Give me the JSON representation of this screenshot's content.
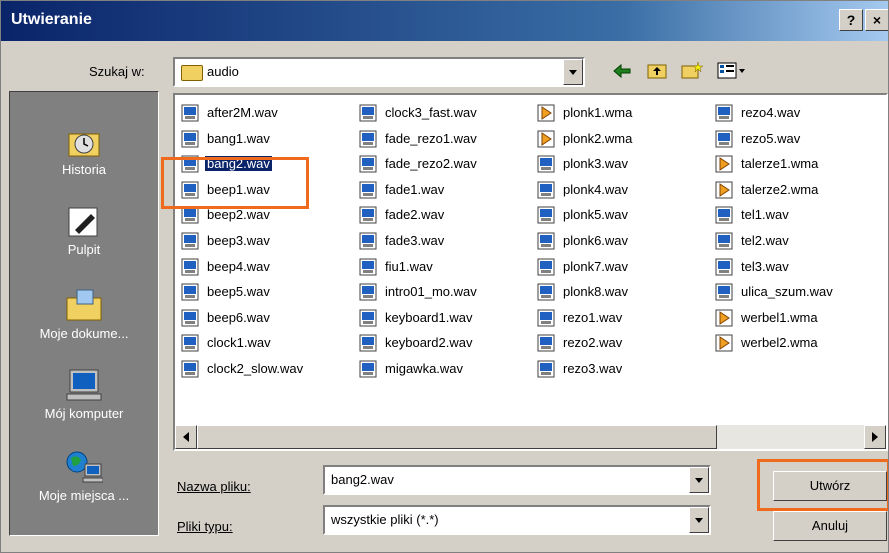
{
  "window": {
    "title": "Utwieranie",
    "help": "?",
    "close": "×"
  },
  "lookin": {
    "label": "Szukaj w:",
    "value": "audio"
  },
  "places": [
    "Historia",
    "Pulpit",
    "Moje dokume...",
    "Mój komputer",
    "Moje miejsca ..."
  ],
  "files": [
    [
      "after2M.wav",
      "bang1.wav",
      "bang2.wav",
      "beep1.wav",
      "beep2.wav",
      "beep3.wav",
      "beep4.wav",
      "beep5.wav",
      "beep6.wav",
      "clock1.wav",
      "clock2_slow.wav"
    ],
    [
      "clock3_fast.wav",
      "fade_rezo1.wav",
      "fade_rezo2.wav",
      "fade1.wav",
      "fade2.wav",
      "fade3.wav",
      "fiu1.wav",
      "intro01_mo.wav",
      "keyboard1.wav",
      "keyboard2.wav",
      "migawka.wav"
    ],
    [
      "plonk1.wma",
      "plonk2.wma",
      "plonk3.wav",
      "plonk4.wav",
      "plonk5.wav",
      "plonk6.wav",
      "plonk7.wav",
      "plonk8.wav",
      "rezo1.wav",
      "rezo2.wav",
      "rezo3.wav"
    ],
    [
      "rezo4.wav",
      "rezo5.wav",
      "talerze1.wma",
      "talerze2.wma",
      "tel1.wav",
      "tel2.wav",
      "tel3.wav",
      "ulica_szum.wav",
      "werbel1.wma",
      "werbel2.wma"
    ]
  ],
  "selected_file": "bang2.wav",
  "filename": {
    "label": "Nazwa pliku:",
    "value": "bang2.wav"
  },
  "filetype": {
    "label": "Pliki typu:",
    "value": "wszystkie pliki (*.*)"
  },
  "buttons": {
    "open": "Utwórz",
    "cancel": "Anuluj"
  },
  "colors": {
    "highlight": "#f06a1e",
    "title_bar": "#0a246a",
    "selection": "#0a246a"
  }
}
